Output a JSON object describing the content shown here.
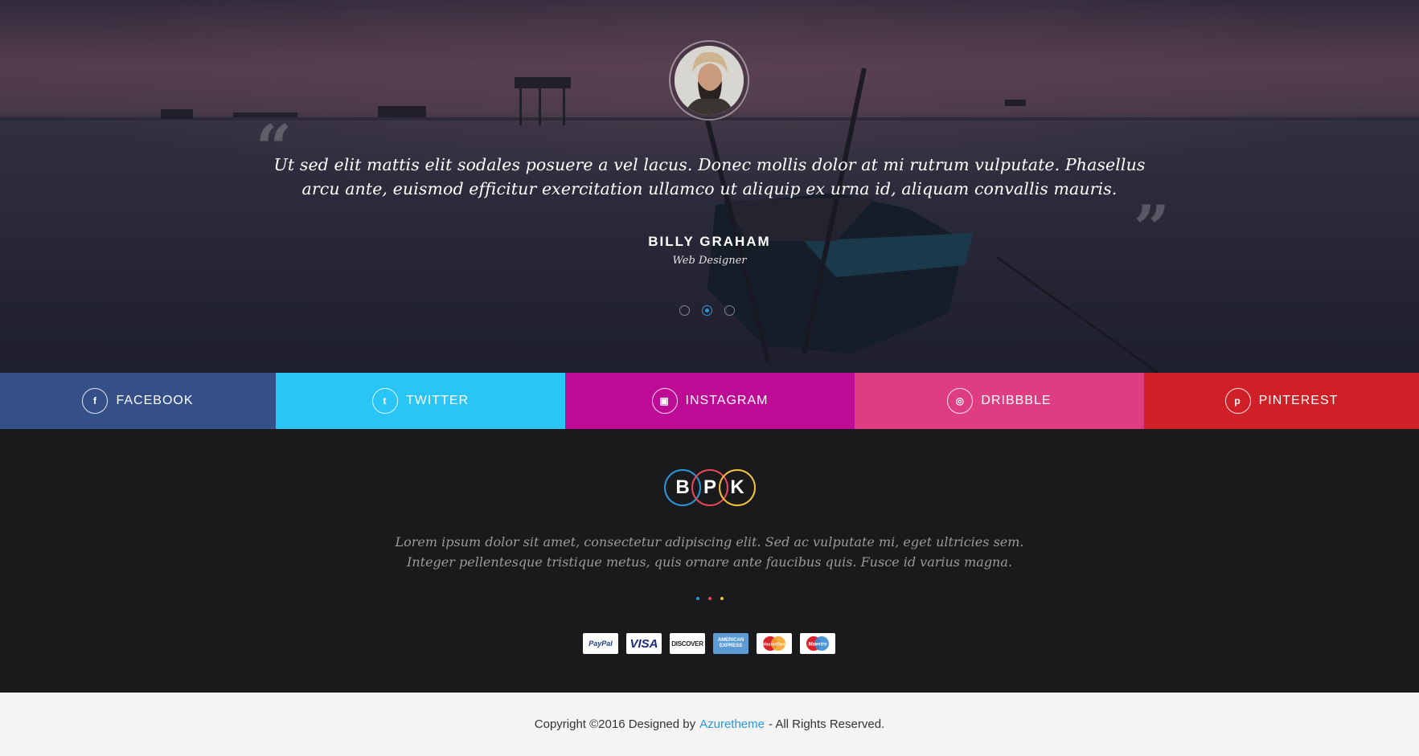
{
  "testimonial": {
    "quote": "Ut sed elit mattis elit sodales posuere a vel lacus. Donec mollis dolor at mi rutrum vulputate. Phasellus arcu ante, euismod efficitur exercitation ullamco ut aliquip ex urna id, aliquam convallis mauris.",
    "open_quote_mark": "“",
    "close_quote_mark": "”",
    "author_name": "BILLY GRAHAM",
    "author_role": "Web Designer",
    "slides": 3,
    "active_slide": 2
  },
  "social": [
    {
      "label": "FACEBOOK",
      "icon": "facebook-icon",
      "glyph": "f",
      "color": "#354f88"
    },
    {
      "label": "TWITTER",
      "icon": "twitter-icon",
      "glyph": "t",
      "color": "#29c5f6"
    },
    {
      "label": "INSTAGRAM",
      "icon": "instagram-icon",
      "glyph": "▣",
      "color": "#be0b96"
    },
    {
      "label": "DRIBBBLE",
      "icon": "dribbble-icon",
      "glyph": "◎",
      "color": "#df3d82"
    },
    {
      "label": "PINTEREST",
      "icon": "pinterest-icon",
      "glyph": "p",
      "color": "#cf2027"
    }
  ],
  "logo": {
    "letters": [
      "B",
      "P",
      "K"
    ],
    "ring_colors": [
      "#2a97d8",
      "#e84858",
      "#f3c33b"
    ]
  },
  "footer": {
    "text": "Lorem ipsum dolor sit amet, consectetur adipiscing elit. Sed ac vulputate mi, eget ultricies sem. Integer pellentesque tristique metus, quis ornare ante faucibus quis. Fusce id varius magna.",
    "dot_colors": [
      "#2a97d8",
      "#e84858",
      "#f3c33b"
    ]
  },
  "payments": [
    {
      "name": "PayPal",
      "icon": "paypal-icon"
    },
    {
      "name": "VISA",
      "icon": "visa-icon"
    },
    {
      "name": "DISCOVER",
      "icon": "discover-icon"
    },
    {
      "name": "AMERICAN EXPRESS",
      "icon": "american-express-icon"
    },
    {
      "name": "MasterCard",
      "icon": "mastercard-icon"
    },
    {
      "name": "Maestro",
      "icon": "maestro-icon"
    }
  ],
  "copyright": {
    "prefix": "Copyright ©2016 Designed by",
    "link": "Azuretheme",
    "suffix": "- All Rights Reserved."
  }
}
